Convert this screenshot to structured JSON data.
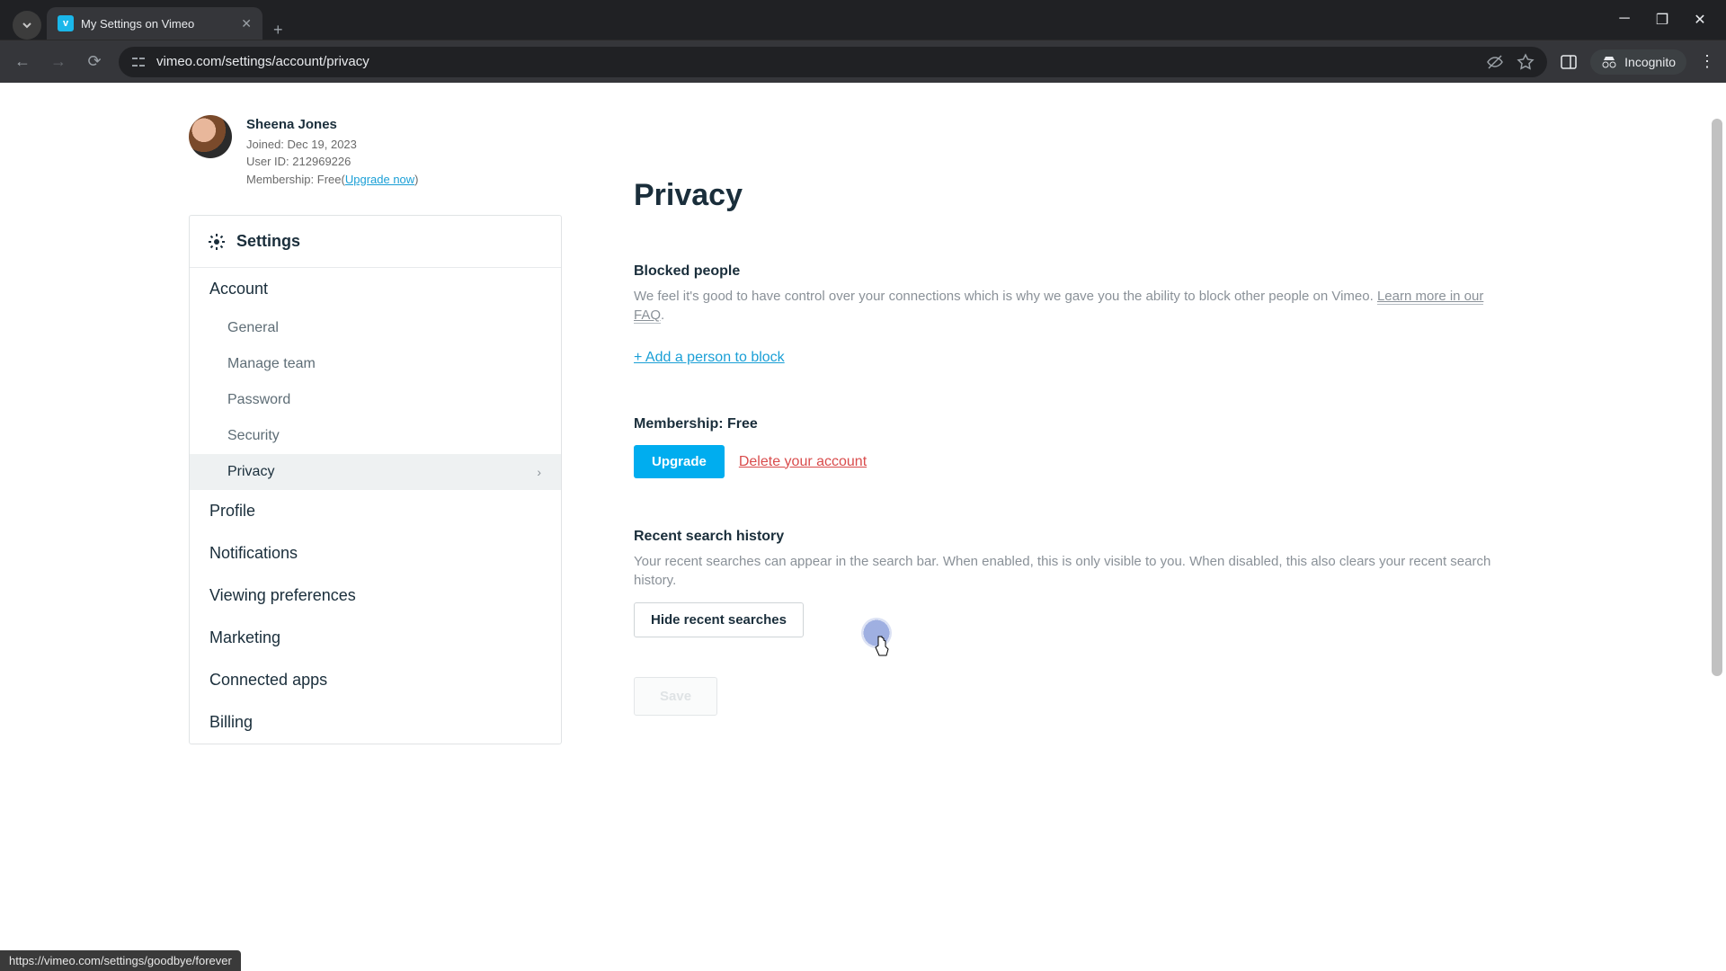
{
  "browser": {
    "tab_title": "My Settings on Vimeo",
    "favicon_letter": "v",
    "url": "vimeo.com/settings/account/privacy",
    "incognito_label": "Incognito",
    "status_url": "https://vimeo.com/settings/goodbye/forever"
  },
  "profile": {
    "name": "Sheena Jones",
    "joined_label": "Joined:",
    "joined_date": "Dec 19, 2023",
    "userid_label": "User ID:",
    "userid_value": "212969226",
    "membership_label": "Membership:",
    "membership_value": "Free",
    "upgrade_now": "Upgrade now"
  },
  "sidebar": {
    "title": "Settings",
    "items": {
      "account": "Account",
      "general": "General",
      "manage_team": "Manage team",
      "password": "Password",
      "security": "Security",
      "privacy": "Privacy",
      "profile": "Profile",
      "notifications": "Notifications",
      "viewing": "Viewing preferences",
      "marketing": "Marketing",
      "connected": "Connected apps",
      "billing": "Billing"
    }
  },
  "page": {
    "title": "Privacy",
    "blocked": {
      "title": "Blocked people",
      "desc": "We feel it's good to have control over your connections which is why we gave you the ability to block other people on Vimeo.",
      "faq": "Learn more in our FAQ",
      "add": "+ Add a person to block"
    },
    "membership": {
      "title": "Membership: Free",
      "upgrade": "Upgrade",
      "delete": "Delete your account"
    },
    "search": {
      "title": "Recent search history",
      "desc": "Your recent searches can appear in the search bar. When enabled, this is only visible to you. When disabled, this also clears your recent search history.",
      "hide": "Hide recent searches"
    },
    "save": "Save"
  }
}
